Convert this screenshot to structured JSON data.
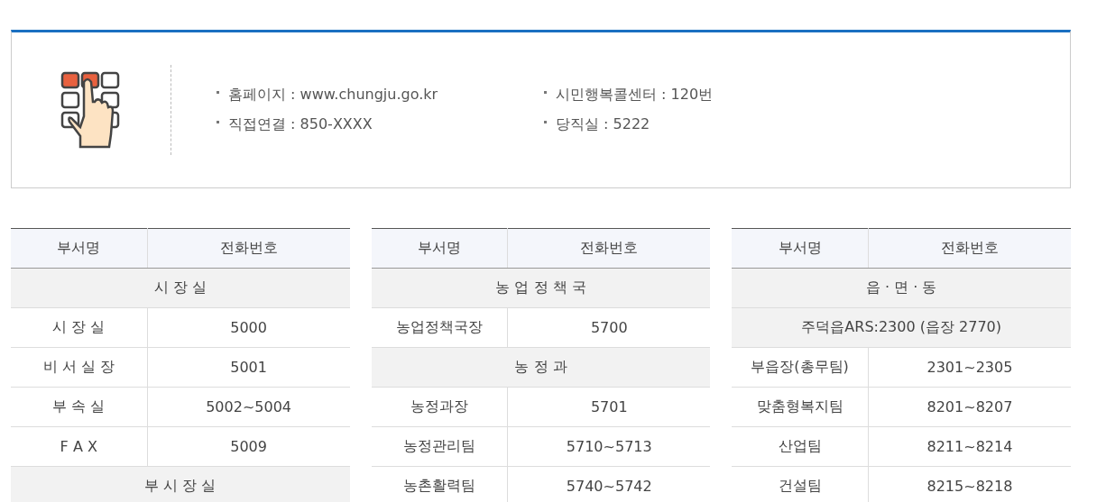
{
  "contact_panel": {
    "items": [
      {
        "text": "홈페이지 : www.chungju.go.kr"
      },
      {
        "text": "시민행복콜센터 : 120번"
      },
      {
        "text": "직접연결 : 850-XXXX"
      },
      {
        "text": "당직실 : 5222"
      }
    ]
  },
  "tables": [
    {
      "columns": [
        "부서명",
        "전화번호"
      ],
      "rows": [
        {
          "kind": "section",
          "text": "시 장 실"
        },
        {
          "kind": "entry",
          "name": "시 장 실",
          "phone": "5000"
        },
        {
          "kind": "entry",
          "name": "비 서 실 장",
          "phone": "5001"
        },
        {
          "kind": "entry",
          "name": "부 속 실",
          "phone": "5002~5004"
        },
        {
          "kind": "entry",
          "name": "F A X",
          "phone": "5009"
        },
        {
          "kind": "section",
          "text": "부 시 장 실"
        }
      ]
    },
    {
      "columns": [
        "부서명",
        "전화번호"
      ],
      "rows": [
        {
          "kind": "section",
          "text": "농 업 정 책 국"
        },
        {
          "kind": "entry",
          "name": "농업정책국장",
          "phone": "5700"
        },
        {
          "kind": "section",
          "text": "농 정 과"
        },
        {
          "kind": "entry",
          "name": "농정과장",
          "phone": "5701"
        },
        {
          "kind": "entry",
          "name": "농정관리팀",
          "phone": "5710~5713"
        },
        {
          "kind": "entry",
          "name": "농촌활력팀",
          "phone": "5740~5742"
        }
      ]
    },
    {
      "columns": [
        "부서명",
        "전화번호"
      ],
      "rows": [
        {
          "kind": "section",
          "text": "읍 · 면 · 동"
        },
        {
          "kind": "section",
          "text": "주덕읍ARS:2300 (읍장 2770)"
        },
        {
          "kind": "entry",
          "name": "부읍장(총무팀)",
          "phone": "2301~2305"
        },
        {
          "kind": "entry",
          "name": "맞춤형복지팀",
          "phone": "8201~8207"
        },
        {
          "kind": "entry",
          "name": "산업팀",
          "phone": "8211~8214"
        },
        {
          "kind": "entry",
          "name": "건설팀",
          "phone": "8215~8218"
        }
      ]
    }
  ]
}
